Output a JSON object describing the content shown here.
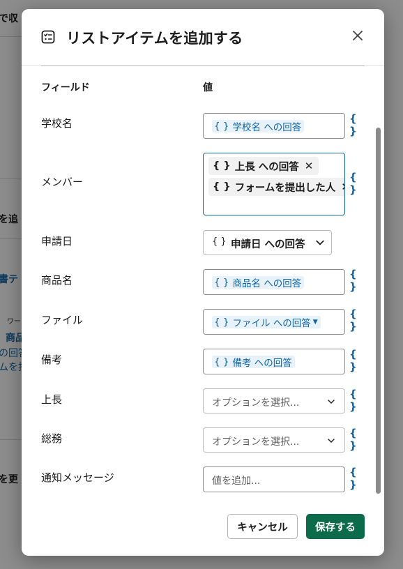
{
  "background": {
    "fragments": [
      "で収",
      "を追",
      "書テ",
      "ワー",
      "商品",
      "の回答",
      "ムを担",
      "を更"
    ]
  },
  "modal": {
    "title": "リストアイテムを追加する",
    "columns": {
      "field": "フィールド",
      "value": "値"
    },
    "var_glyph": "{ }",
    "fields": {
      "school": {
        "label": "学校名",
        "token": "学校名 への回答"
      },
      "members": {
        "label": "メンバー",
        "pills": [
          "上長 への回答",
          "フォームを提出した人"
        ]
      },
      "date": {
        "label": "申請日",
        "value": "申請日 への回答"
      },
      "product": {
        "label": "商品名",
        "token": "商品名 への回答"
      },
      "file": {
        "label": "ファイル",
        "token": "ファイル への回答"
      },
      "notes": {
        "label": "備考",
        "token": "備考 への回答"
      },
      "boss": {
        "label": "上長",
        "placeholder": "オプションを選択..."
      },
      "general": {
        "label": "総務",
        "placeholder": "オプションを選択..."
      },
      "message": {
        "label": "通知メッセージ",
        "placeholder": "値を追加..."
      }
    },
    "buttons": {
      "cancel": "キャンセル",
      "save": "保存する"
    }
  },
  "colors": {
    "accent": "#1264a3",
    "primary": "#0c6b4b",
    "token_bg": "#e8f2fb"
  }
}
